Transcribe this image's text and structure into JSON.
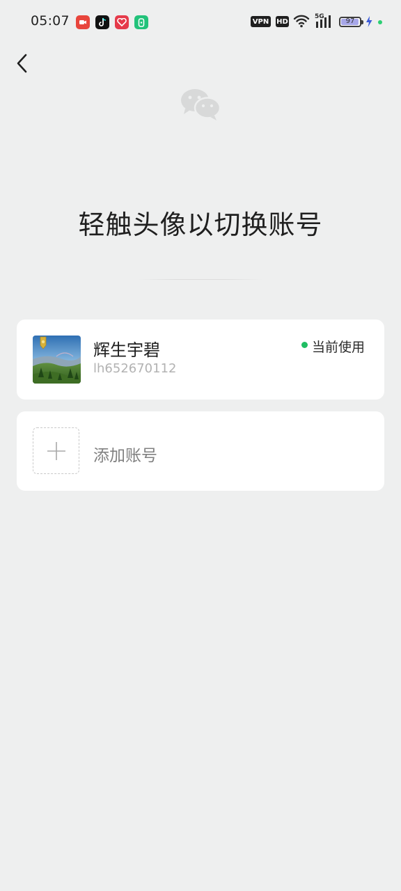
{
  "status_bar": {
    "time": "05:07",
    "apps": [
      "video-app-icon",
      "tiktok-icon",
      "heart-app-icon",
      "green-app-icon"
    ],
    "vpn_label": "VPN",
    "hd_label": "HD",
    "signal_label": "5G",
    "battery_level": "97",
    "battery_fraction": 0.97,
    "charging": true
  },
  "header": {
    "back_icon": "chevron-left-icon",
    "logo_icon": "wechat-logo-icon"
  },
  "title": "轻触头像以切换账号",
  "accounts": [
    {
      "name": "辉生宇碧",
      "id": "lh652670112",
      "status_label": "当前使用",
      "status_color": "#1fbe63"
    }
  ],
  "add_account": {
    "label": "添加账号"
  },
  "colors": {
    "background": "#eeefef",
    "card": "#ffffff",
    "accent_green": "#1fbe63"
  }
}
